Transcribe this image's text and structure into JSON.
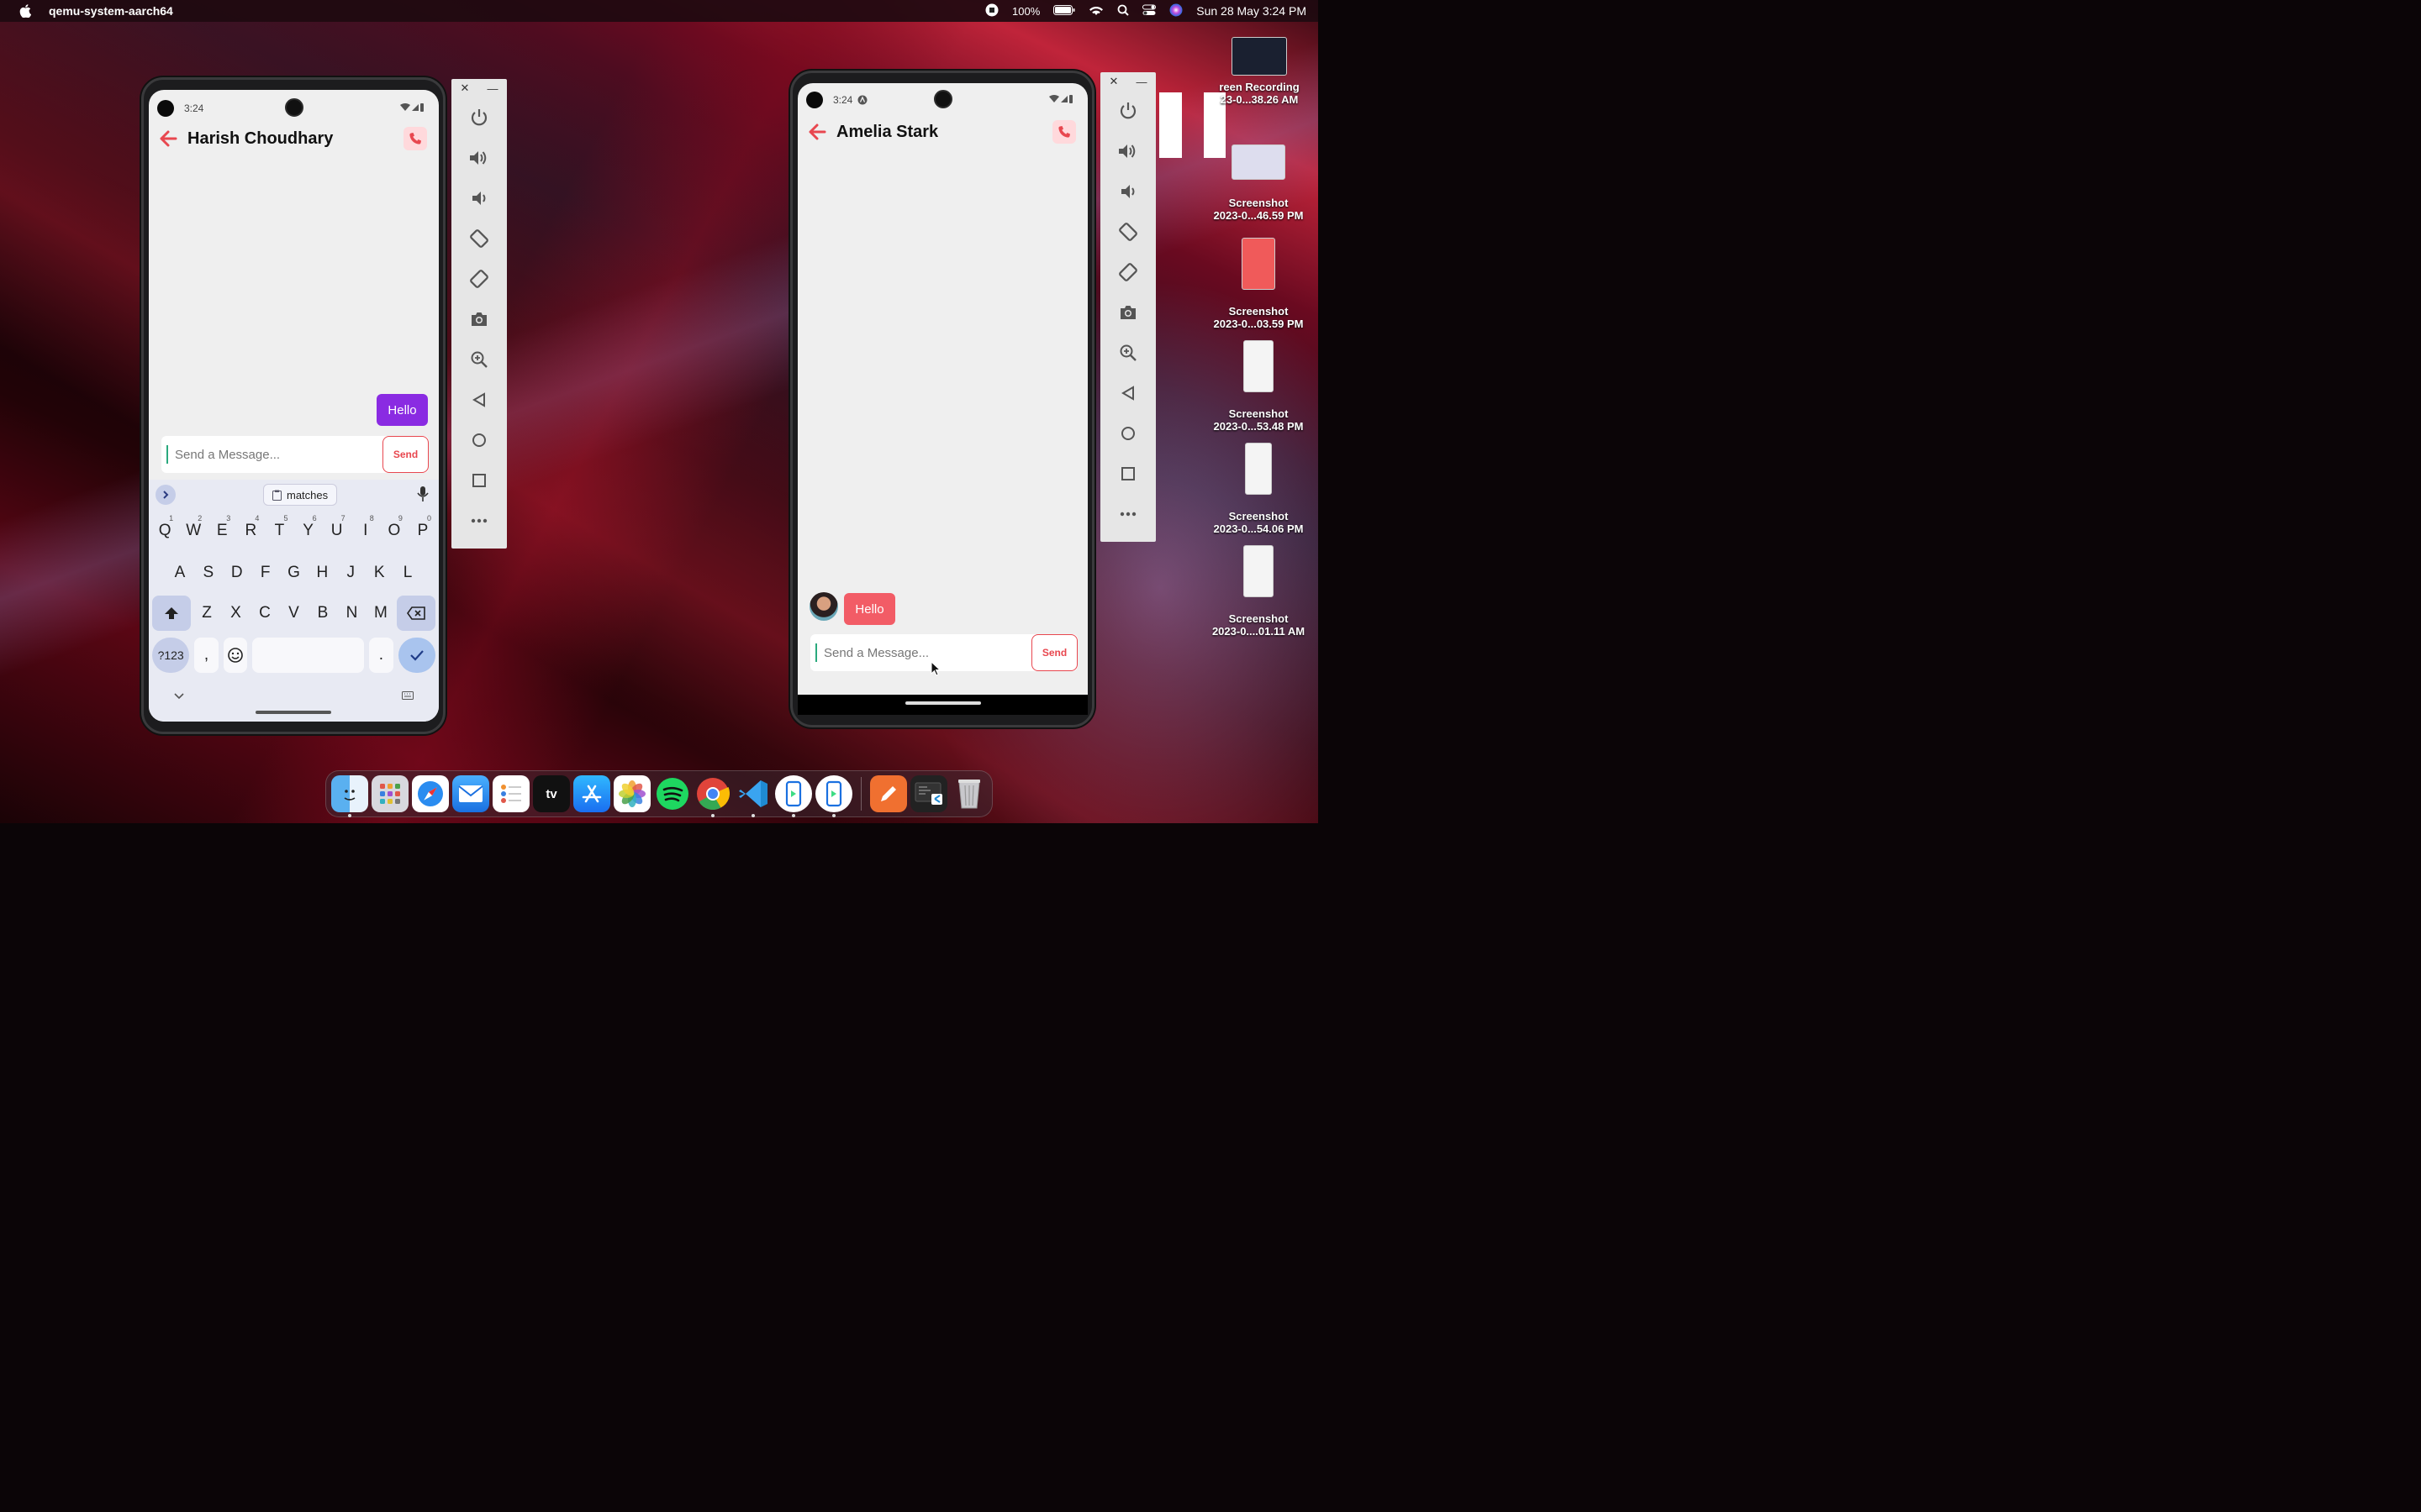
{
  "menubar": {
    "app_name": "qemu-system-aarch64",
    "battery": "100%",
    "datetime": "Sun 28 May  3:24 PM"
  },
  "emulator_left": {
    "time": "3:24",
    "contact": "Harish Choudhary",
    "message_sent": "Hello",
    "input_placeholder": "Send a Message...",
    "send_label": "Send",
    "suggestion": "matches",
    "keyboard": {
      "row1": [
        {
          "k": "Q",
          "n": "1"
        },
        {
          "k": "W",
          "n": "2"
        },
        {
          "k": "E",
          "n": "3"
        },
        {
          "k": "R",
          "n": "4"
        },
        {
          "k": "T",
          "n": "5"
        },
        {
          "k": "Y",
          "n": "6"
        },
        {
          "k": "U",
          "n": "7"
        },
        {
          "k": "I",
          "n": "8"
        },
        {
          "k": "O",
          "n": "9"
        },
        {
          "k": "P",
          "n": "0"
        }
      ],
      "row2": [
        "A",
        "S",
        "D",
        "F",
        "G",
        "H",
        "J",
        "K",
        "L"
      ],
      "row3": [
        "Z",
        "X",
        "C",
        "V",
        "B",
        "N",
        "M"
      ],
      "sym_key": "?123",
      "comma": ",",
      "period": "."
    }
  },
  "emulator_right": {
    "time": "3:24",
    "contact": "Amelia Stark",
    "message_received": "Hello",
    "input_placeholder": "Send a Message...",
    "send_label": "Send"
  },
  "desktop": [
    {
      "line1": "reen Recording",
      "line2": "23-0...38.26 AM"
    },
    {
      "line1": "Screenshot",
      "line2": "2023-0...46.59 PM"
    },
    {
      "line1": "Screenshot",
      "line2": "2023-0...03.59 PM"
    },
    {
      "line1": "Screenshot",
      "line2": "2023-0...53.48 PM"
    },
    {
      "line1": "Screenshot",
      "line2": "2023-0...54.06 PM"
    },
    {
      "line1": "Screenshot",
      "line2": "2023-0....01.11 AM"
    }
  ],
  "dock": [
    "finder-icon",
    "launchpad-icon",
    "safari-icon",
    "mail-icon",
    "reminders-icon",
    "appletv-icon",
    "appstore-icon",
    "photos-icon",
    "spotify-icon",
    "chrome-icon",
    "vscode-icon",
    "android-emulator-icon",
    "android-emulator-icon",
    "pencil-app-icon",
    "terminal-vscode-icon",
    "trash-icon"
  ],
  "colors": {
    "accent_red": "#e8474f",
    "sent_bubble": "#8a2be2",
    "received_bubble": "#f25c66"
  }
}
